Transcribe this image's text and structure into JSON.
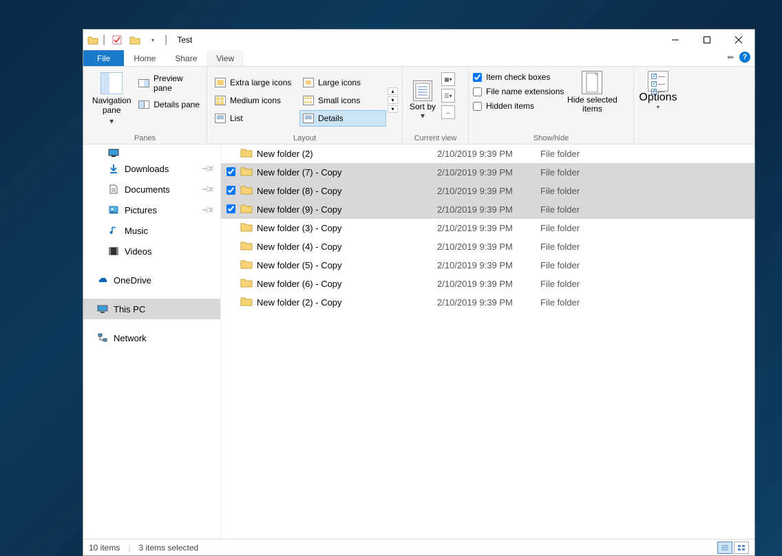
{
  "window": {
    "title": "Test"
  },
  "tabs": {
    "file": "File",
    "home": "Home",
    "share": "Share",
    "view": "View"
  },
  "ribbon": {
    "panes": {
      "group_label": "Panes",
      "navigation_pane": "Navigation pane",
      "preview_pane": "Preview pane",
      "details_pane": "Details pane"
    },
    "layout": {
      "group_label": "Layout",
      "extra_large_icons": "Extra large icons",
      "large_icons": "Large icons",
      "medium_icons": "Medium icons",
      "small_icons": "Small icons",
      "list": "List",
      "details": "Details"
    },
    "current_view": {
      "group_label": "Current view",
      "sort_by": "Sort by"
    },
    "show_hide": {
      "group_label": "Show/hide",
      "item_check_boxes": "Item check boxes",
      "file_name_extensions": "File name extensions",
      "hidden_items": "Hidden items",
      "hide_selected_items": "Hide selected items"
    },
    "options": {
      "label": "Options"
    }
  },
  "sidebar": {
    "desktop": "Desktop",
    "downloads": "Downloads",
    "documents": "Documents",
    "pictures": "Pictures",
    "music": "Music",
    "videos": "Videos",
    "onedrive": "OneDrive",
    "this_pc": "This PC",
    "network": "Network"
  },
  "files": [
    {
      "name": "New folder (2)",
      "modified": "2/10/2019 9:39 PM",
      "type": "File folder",
      "selected": false
    },
    {
      "name": "New folder (7) - Copy",
      "modified": "2/10/2019 9:39 PM",
      "type": "File folder",
      "selected": true
    },
    {
      "name": "New folder (8) - Copy",
      "modified": "2/10/2019 9:39 PM",
      "type": "File folder",
      "selected": true
    },
    {
      "name": "New folder (9) - Copy",
      "modified": "2/10/2019 9:39 PM",
      "type": "File folder",
      "selected": true
    },
    {
      "name": "New folder (3) - Copy",
      "modified": "2/10/2019 9:39 PM",
      "type": "File folder",
      "selected": false
    },
    {
      "name": "New folder (4) - Copy",
      "modified": "2/10/2019 9:39 PM",
      "type": "File folder",
      "selected": false
    },
    {
      "name": "New folder (5) - Copy",
      "modified": "2/10/2019 9:39 PM",
      "type": "File folder",
      "selected": false
    },
    {
      "name": "New folder (6) - Copy",
      "modified": "2/10/2019 9:39 PM",
      "type": "File folder",
      "selected": false
    },
    {
      "name": "New folder (2) - Copy",
      "modified": "2/10/2019 9:39 PM",
      "type": "File folder",
      "selected": false
    }
  ],
  "status": {
    "item_count": "10 items",
    "selection": "3 items selected"
  }
}
